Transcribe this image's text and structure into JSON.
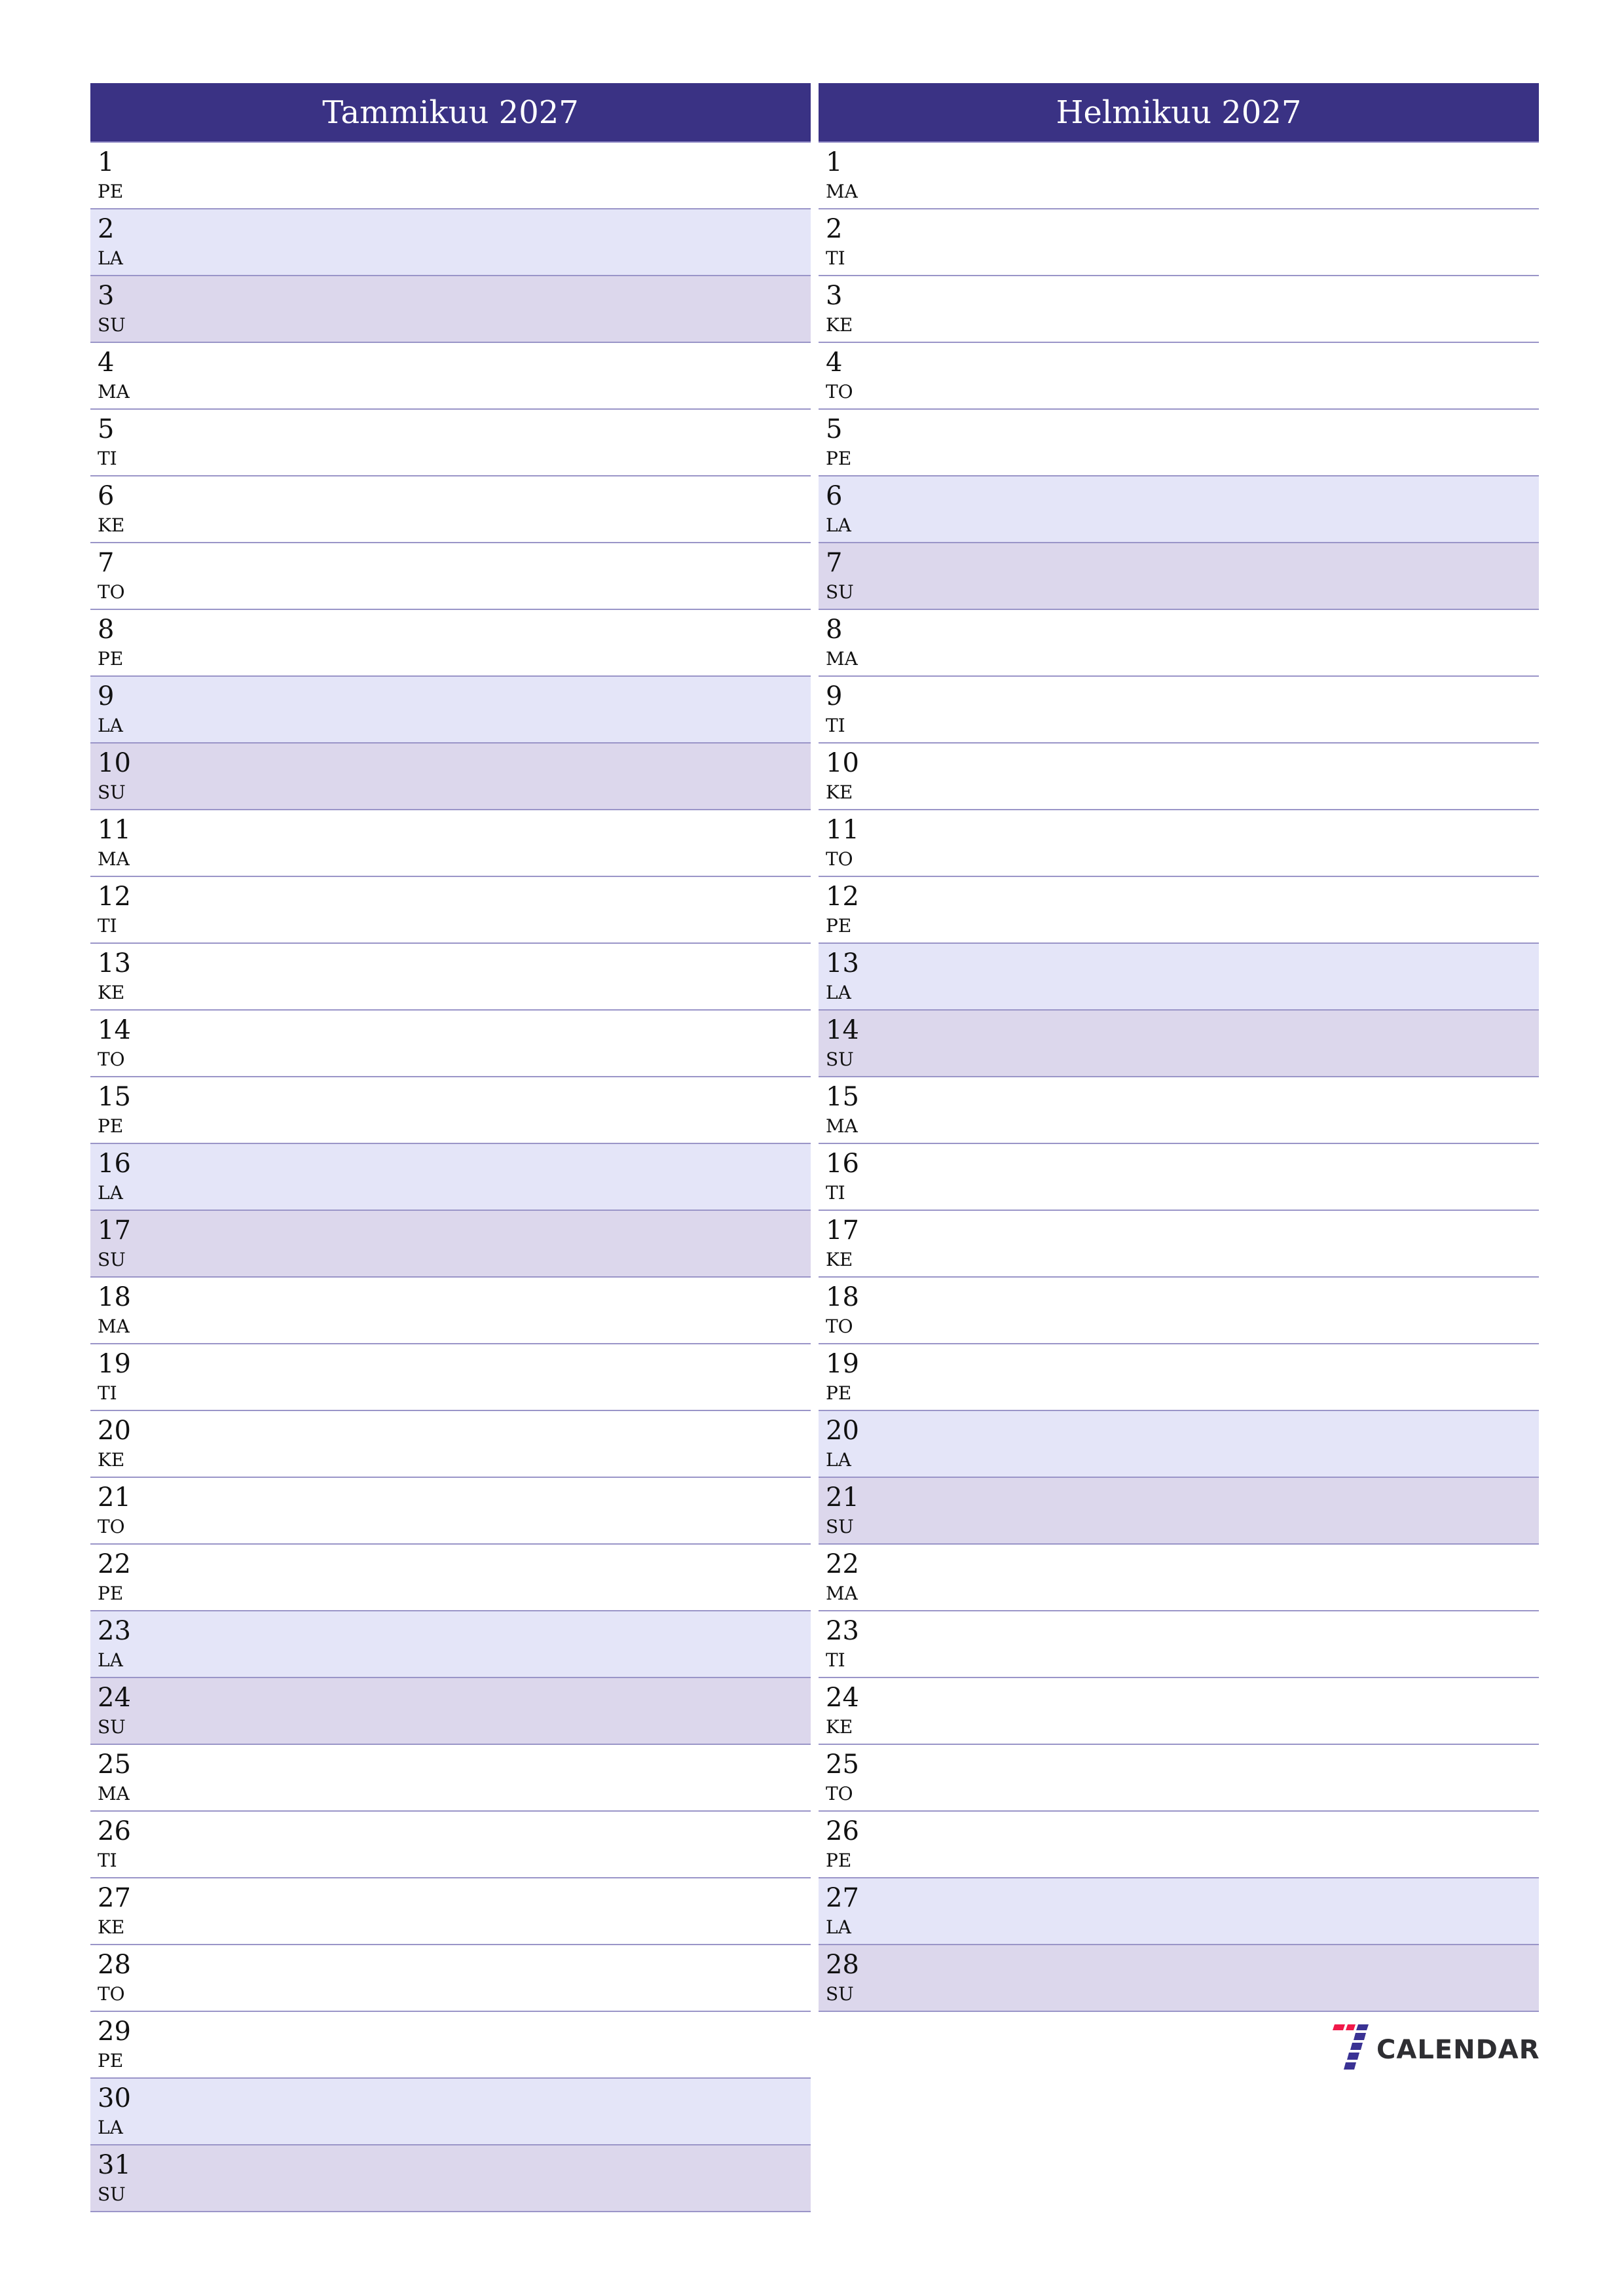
{
  "months": [
    {
      "title": "Tammikuu 2027",
      "days": [
        {
          "num": "1",
          "name": "PE",
          "type": "weekday"
        },
        {
          "num": "2",
          "name": "LA",
          "type": "sat"
        },
        {
          "num": "3",
          "name": "SU",
          "type": "sun"
        },
        {
          "num": "4",
          "name": "MA",
          "type": "weekday"
        },
        {
          "num": "5",
          "name": "TI",
          "type": "weekday"
        },
        {
          "num": "6",
          "name": "KE",
          "type": "weekday"
        },
        {
          "num": "7",
          "name": "TO",
          "type": "weekday"
        },
        {
          "num": "8",
          "name": "PE",
          "type": "weekday"
        },
        {
          "num": "9",
          "name": "LA",
          "type": "sat"
        },
        {
          "num": "10",
          "name": "SU",
          "type": "sun"
        },
        {
          "num": "11",
          "name": "MA",
          "type": "weekday"
        },
        {
          "num": "12",
          "name": "TI",
          "type": "weekday"
        },
        {
          "num": "13",
          "name": "KE",
          "type": "weekday"
        },
        {
          "num": "14",
          "name": "TO",
          "type": "weekday"
        },
        {
          "num": "15",
          "name": "PE",
          "type": "weekday"
        },
        {
          "num": "16",
          "name": "LA",
          "type": "sat"
        },
        {
          "num": "17",
          "name": "SU",
          "type": "sun"
        },
        {
          "num": "18",
          "name": "MA",
          "type": "weekday"
        },
        {
          "num": "19",
          "name": "TI",
          "type": "weekday"
        },
        {
          "num": "20",
          "name": "KE",
          "type": "weekday"
        },
        {
          "num": "21",
          "name": "TO",
          "type": "weekday"
        },
        {
          "num": "22",
          "name": "PE",
          "type": "weekday"
        },
        {
          "num": "23",
          "name": "LA",
          "type": "sat"
        },
        {
          "num": "24",
          "name": "SU",
          "type": "sun"
        },
        {
          "num": "25",
          "name": "MA",
          "type": "weekday"
        },
        {
          "num": "26",
          "name": "TI",
          "type": "weekday"
        },
        {
          "num": "27",
          "name": "KE",
          "type": "weekday"
        },
        {
          "num": "28",
          "name": "TO",
          "type": "weekday"
        },
        {
          "num": "29",
          "name": "PE",
          "type": "weekday"
        },
        {
          "num": "30",
          "name": "LA",
          "type": "sat"
        },
        {
          "num": "31",
          "name": "SU",
          "type": "sun"
        }
      ]
    },
    {
      "title": "Helmikuu 2027",
      "days": [
        {
          "num": "1",
          "name": "MA",
          "type": "weekday"
        },
        {
          "num": "2",
          "name": "TI",
          "type": "weekday"
        },
        {
          "num": "3",
          "name": "KE",
          "type": "weekday"
        },
        {
          "num": "4",
          "name": "TO",
          "type": "weekday"
        },
        {
          "num": "5",
          "name": "PE",
          "type": "weekday"
        },
        {
          "num": "6",
          "name": "LA",
          "type": "sat"
        },
        {
          "num": "7",
          "name": "SU",
          "type": "sun"
        },
        {
          "num": "8",
          "name": "MA",
          "type": "weekday"
        },
        {
          "num": "9",
          "name": "TI",
          "type": "weekday"
        },
        {
          "num": "10",
          "name": "KE",
          "type": "weekday"
        },
        {
          "num": "11",
          "name": "TO",
          "type": "weekday"
        },
        {
          "num": "12",
          "name": "PE",
          "type": "weekday"
        },
        {
          "num": "13",
          "name": "LA",
          "type": "sat"
        },
        {
          "num": "14",
          "name": "SU",
          "type": "sun"
        },
        {
          "num": "15",
          "name": "MA",
          "type": "weekday"
        },
        {
          "num": "16",
          "name": "TI",
          "type": "weekday"
        },
        {
          "num": "17",
          "name": "KE",
          "type": "weekday"
        },
        {
          "num": "18",
          "name": "TO",
          "type": "weekday"
        },
        {
          "num": "19",
          "name": "PE",
          "type": "weekday"
        },
        {
          "num": "20",
          "name": "LA",
          "type": "sat"
        },
        {
          "num": "21",
          "name": "SU",
          "type": "sun"
        },
        {
          "num": "22",
          "name": "MA",
          "type": "weekday"
        },
        {
          "num": "23",
          "name": "TI",
          "type": "weekday"
        },
        {
          "num": "24",
          "name": "KE",
          "type": "weekday"
        },
        {
          "num": "25",
          "name": "TO",
          "type": "weekday"
        },
        {
          "num": "26",
          "name": "PE",
          "type": "weekday"
        },
        {
          "num": "27",
          "name": "LA",
          "type": "sat"
        },
        {
          "num": "28",
          "name": "SU",
          "type": "sun"
        }
      ]
    }
  ],
  "logo": {
    "text": "CALENDAR",
    "mark": "7-logo-icon"
  },
  "colors": {
    "header": "#3a3284",
    "saturday": "#e4e5f8",
    "sunday": "#dcd7ec",
    "logo_red": "#f0194a",
    "logo_blue": "#3a3294"
  }
}
